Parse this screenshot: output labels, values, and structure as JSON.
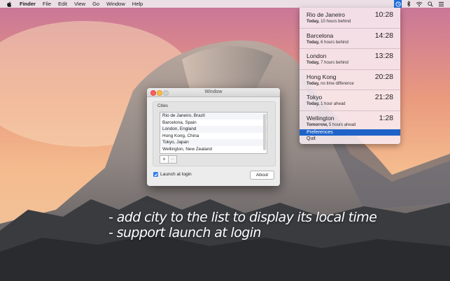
{
  "menubar": {
    "app_name": "Finder",
    "items": [
      "File",
      "Edit",
      "View",
      "Go",
      "Window",
      "Help"
    ],
    "icons": [
      "apple-icon",
      "world-clock-status-icon",
      "bluetooth-icon",
      "wifi-icon",
      "search-icon",
      "list-icon"
    ]
  },
  "dropdown": {
    "cities": [
      {
        "name": "Rio de Janeiro",
        "time": "10:28",
        "day": "Today,",
        "offset": "10 hours behind"
      },
      {
        "name": "Barcelona",
        "time": "14:28",
        "day": "Today,",
        "offset": "6 hours behind"
      },
      {
        "name": "London",
        "time": "13:28",
        "day": "Today,",
        "offset": "7 hours behind"
      },
      {
        "name": "Hong Kong",
        "time": "20:28",
        "day": "Today,",
        "offset": "no time difference"
      },
      {
        "name": "Tokyo",
        "time": "21:28",
        "day": "Today,",
        "offset": "1 hour ahead"
      },
      {
        "name": "Wellington",
        "time": "1:28",
        "day": "Tomorrow,",
        "offset": "5 hours ahead"
      }
    ],
    "preferences": "Preferences",
    "quit": "Quit"
  },
  "window": {
    "title": "Window",
    "cities_label": "Cities",
    "list": [
      "Rio de Janeiro, Brazil",
      "Barcelona, Spain",
      "London, England",
      "Hong Kong, China",
      "Tokyo, Japan",
      "Wellington, New Zealand"
    ],
    "add_label": "+",
    "remove_label": "−",
    "launch_label": "Launch at login",
    "launch_checked": true,
    "about_label": "About"
  },
  "captions": {
    "line1": "- add city to the list to display its local time",
    "line2": "- support launch at login"
  },
  "colors": {
    "accent": "#1f63c9",
    "checkbox": "#2f7fef"
  }
}
